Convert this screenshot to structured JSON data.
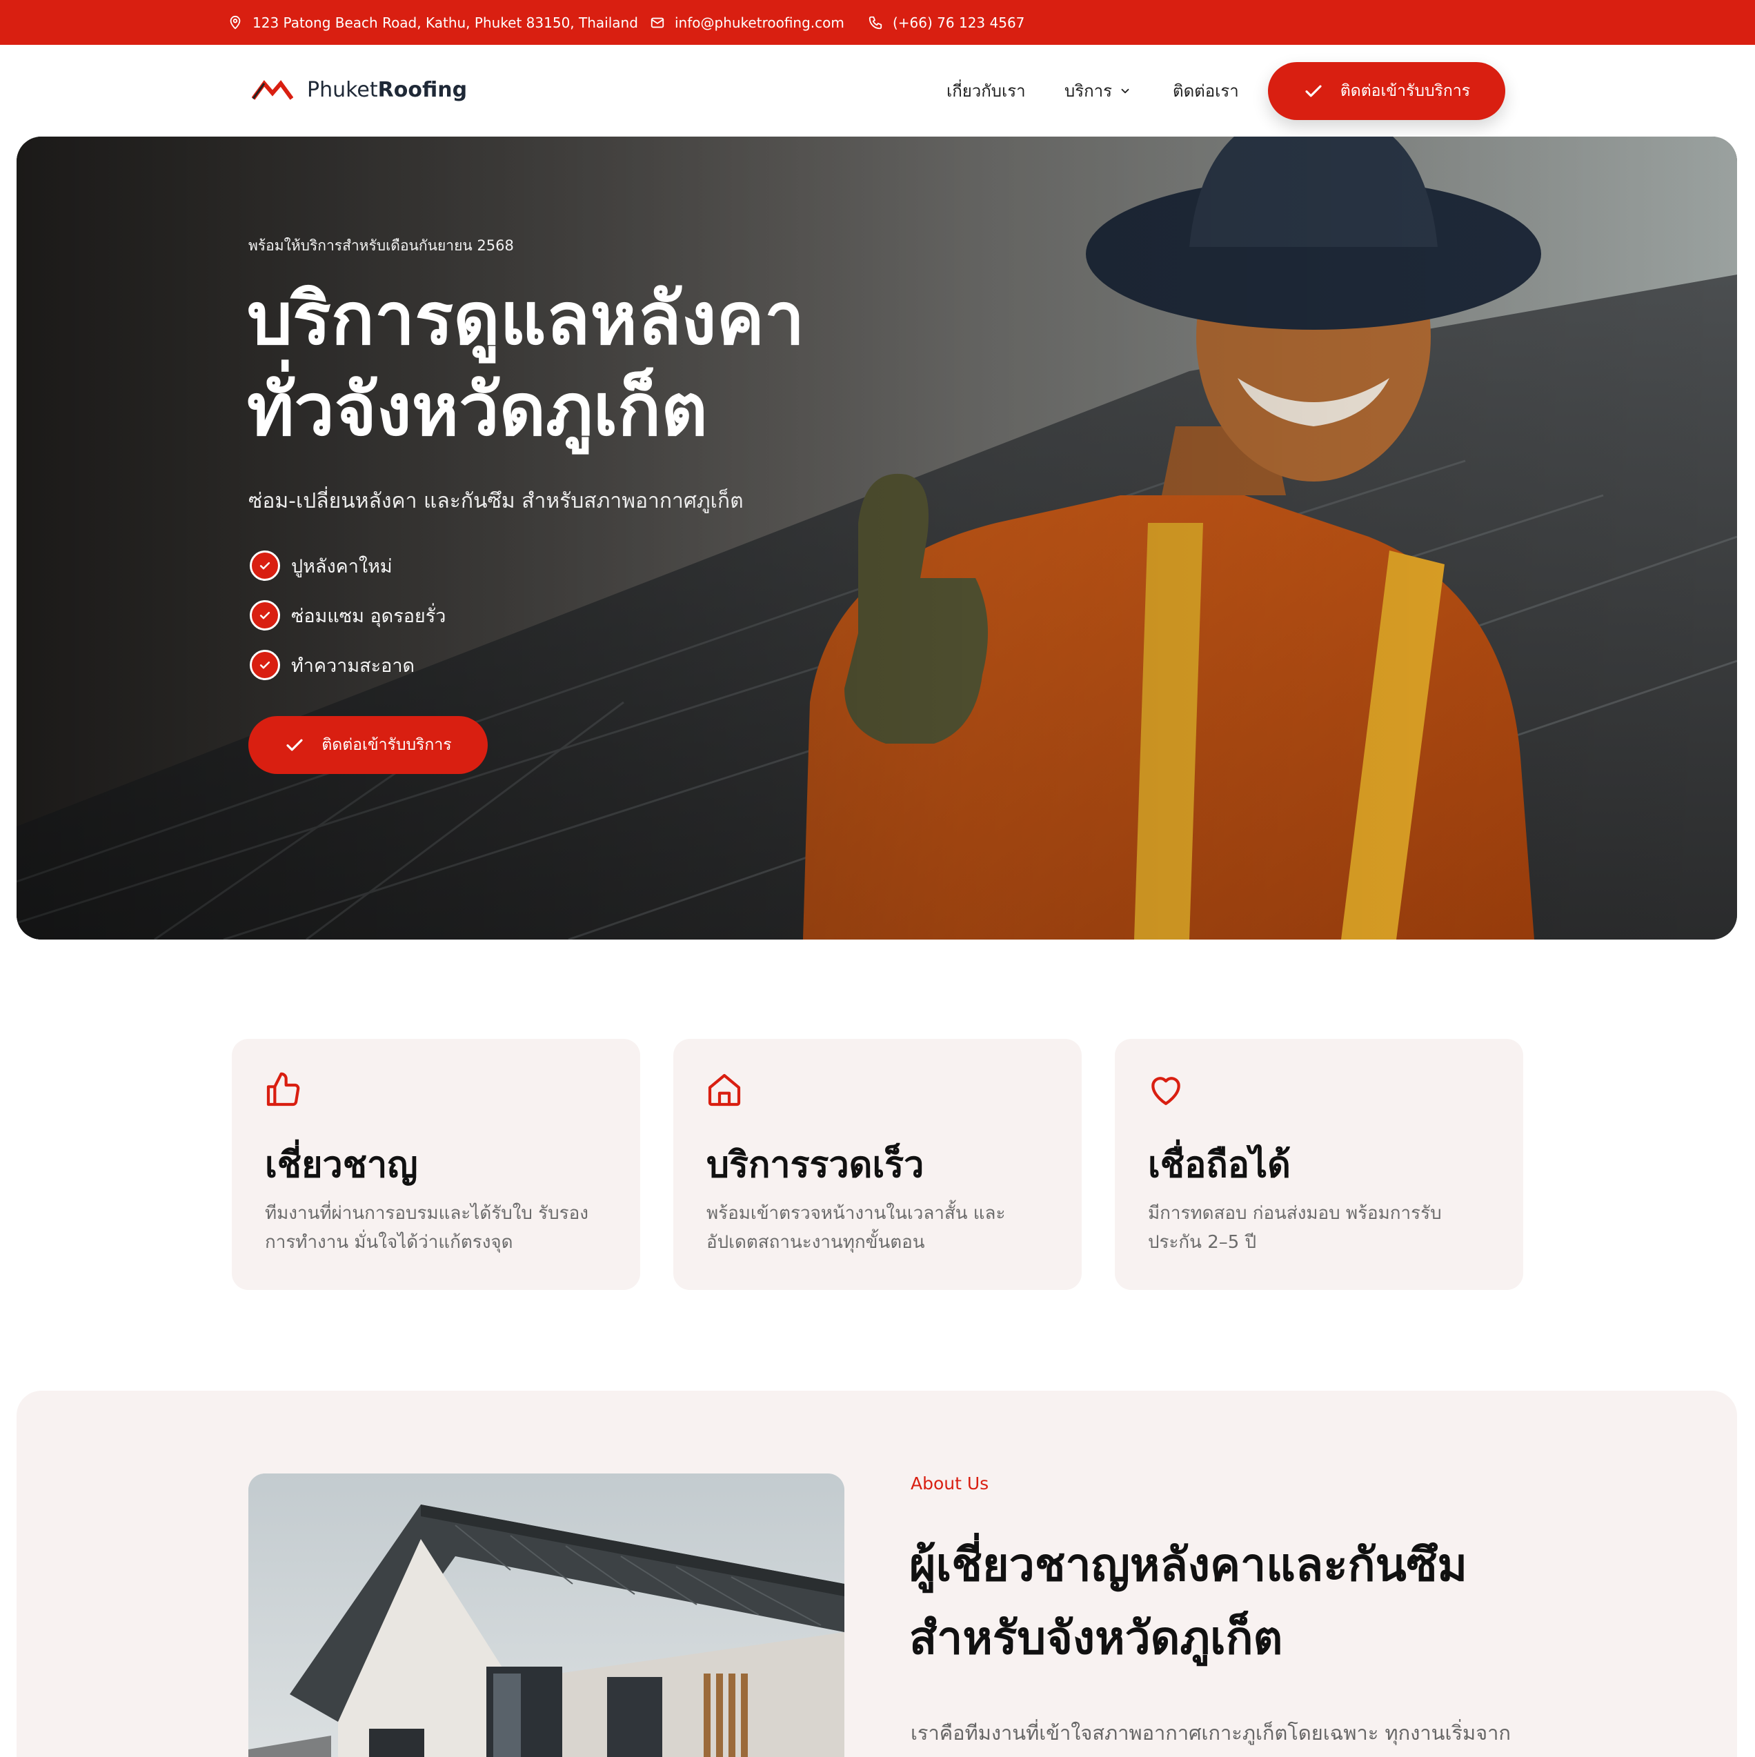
{
  "topbar": {
    "address": "123 Patong Beach Road, Kathu, Phuket 83150, Thailand",
    "email": "info@phuketroofing.com",
    "phone": "(+66) 76 123 4567"
  },
  "header": {
    "logo_text_regular": "Phuket",
    "logo_text_bold": "Roofing",
    "nav": {
      "about": "เกี่ยวกับเรา",
      "services": "บริการ",
      "contact": "ติดต่อเรา"
    },
    "cta_label": "ติดต่อเข้ารับบริการ"
  },
  "hero": {
    "kicker": "พร้อมให้บริการสำหรับเดือนกันยายน 2568",
    "title_line1": "บริการดูแลหลังคา",
    "title_line2": "ทั่วจังหวัดภูเก็ต",
    "subtitle": "ซ่อม-เปลี่ยนหลังคา และกันซึม สำหรับสภาพอากาศภูเก็ต",
    "checklist": [
      "ปูหลังคาใหม่",
      "ซ่อมแซม อุดรอยรั่ว",
      "ทำความสะอาด"
    ],
    "cta_label": "ติดต่อเข้ารับบริการ"
  },
  "features": [
    {
      "icon": "thumbs-up-icon",
      "title": "เชี่ยวชาญ",
      "text": "ทีมงานที่ผ่านการอบรมและได้รับใบ รับรองการทำงาน มั่นใจได้ว่าแก้ตรงจุด"
    },
    {
      "icon": "home-icon",
      "title": "บริการรวดเร็ว",
      "text": "พร้อมเข้าตรวจหน้างานในเวลาสั้น และอัปเดตสถานะงานทุกขั้นตอน"
    },
    {
      "icon": "heart-icon",
      "title": "เชื่อถือได้",
      "text": "มีการทดสอบ ก่อนส่งมอบ พร้อมการรับประกัน 2–5 ปี"
    }
  ],
  "about": {
    "kicker": "About Us",
    "title_line1": "ผู้เชี่ยวชาญหลังคาและกันซึม",
    "title_line2": "สำหรับจังหวัดภูเก็ต",
    "body": "เราคือทีมงานที่เข้าใจสภาพอากาศเกาะภูเก็ตโดยเฉพาะ ทุกงานเริ่มจาก"
  },
  "colors": {
    "brand_red": "#d91f11",
    "card_bg": "#f8f2f1",
    "text_dark": "#111111",
    "text_muted": "#6b6b6b"
  }
}
